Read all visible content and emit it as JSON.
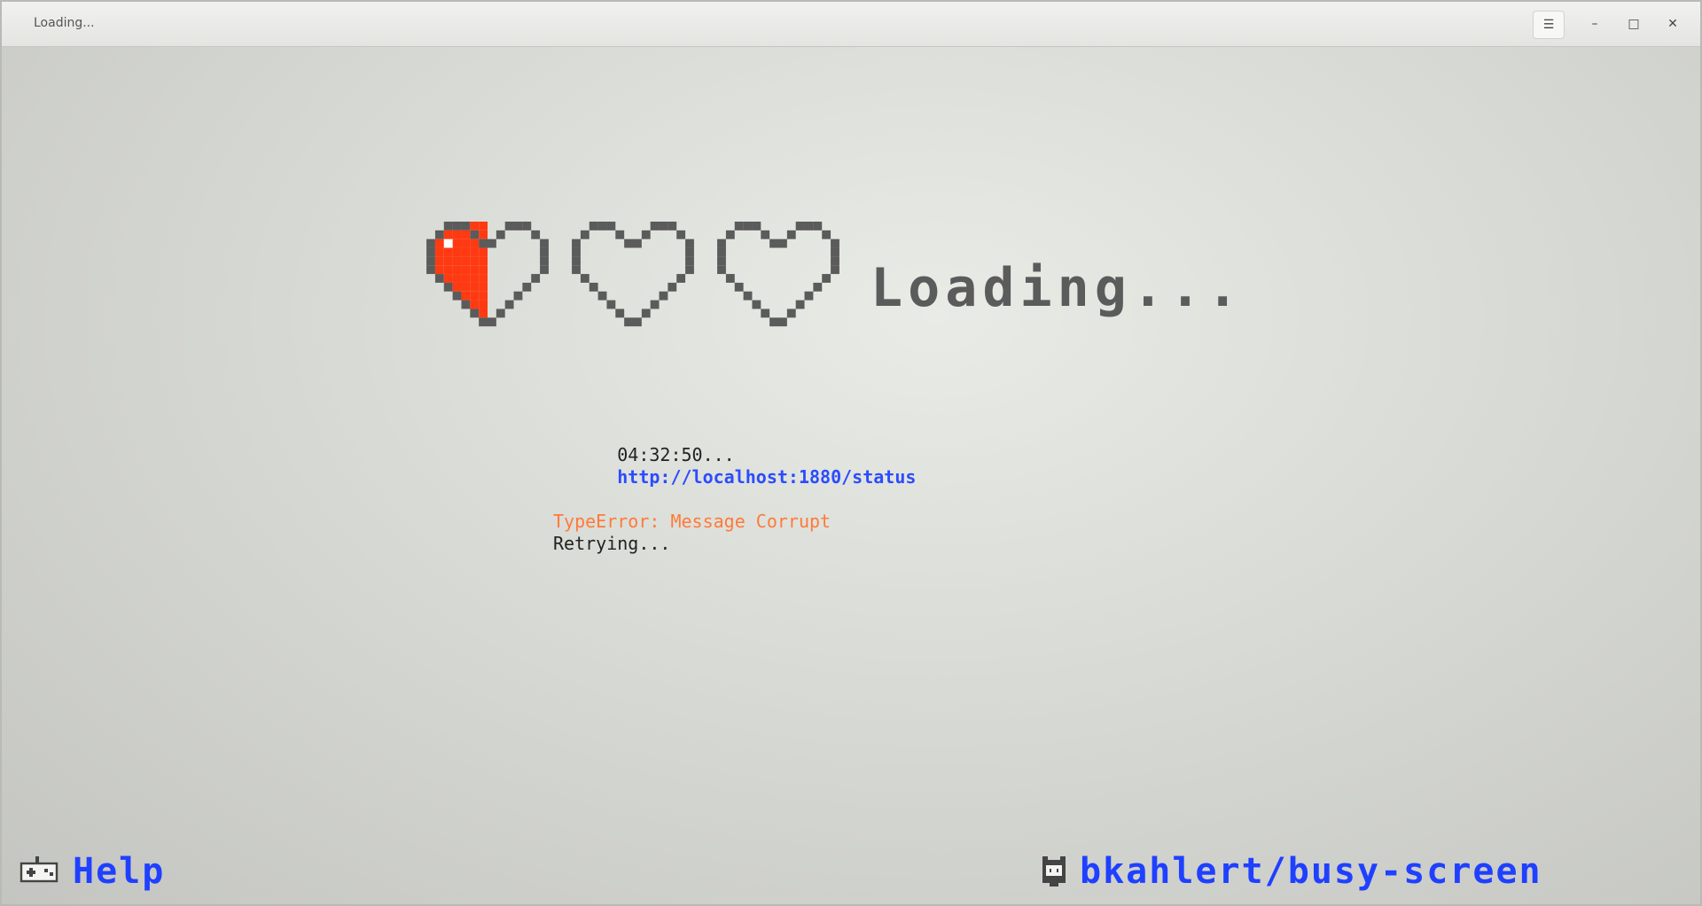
{
  "window": {
    "title": "Loading...",
    "controls": {
      "menu_icon": "hamburger-menu-icon",
      "minimize_icon": "minimize-icon",
      "maximize_icon": "maximize-icon",
      "close_icon": "close-icon"
    }
  },
  "loader": {
    "hearts": [
      {
        "fill": 0.5,
        "color": "#ff3a12"
      },
      {
        "fill": 0,
        "color": "#ff3a12"
      },
      {
        "fill": 0,
        "color": "#ff3a12"
      }
    ],
    "text": "Loading..."
  },
  "log": {
    "timestamp": "04:32:50...",
    "url": "http://localhost:1880/status",
    "error": "TypeError: Message Corrupt",
    "status": "Retrying..."
  },
  "footer": {
    "help_label": "Help",
    "help_icon": "gamepad-icon",
    "repo_label": "bkahlert/busy-screen",
    "repo_icon": "github-octocat-icon"
  },
  "colors": {
    "link": "#1f40ff",
    "error": "#ff7a3a",
    "heart_fill": "#ff3a12",
    "outline": "#5b5b5b"
  }
}
